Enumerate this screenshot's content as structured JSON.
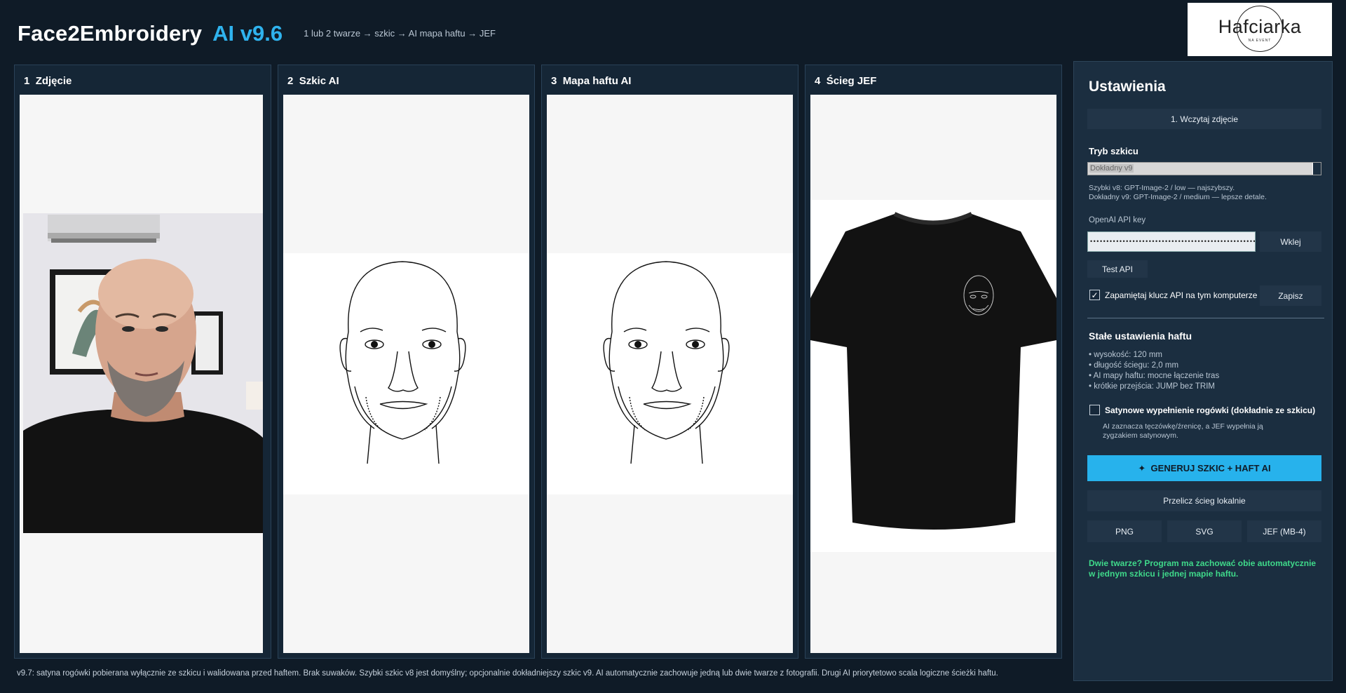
{
  "header": {
    "title": "Face2Embroidery",
    "version": "AI v9.6",
    "subtitle": "1 lub 2 twarze → szkic → AI mapa haftu → JEF",
    "logo_text": "Hafciarka",
    "logo_subtext": "NA EVENT"
  },
  "panels": [
    {
      "number": "1",
      "title": "Zdjęcie"
    },
    {
      "number": "2",
      "title": "Szkic AI"
    },
    {
      "number": "3",
      "title": "Mapa haftu AI"
    },
    {
      "number": "4",
      "title": "Ścieg JEF"
    }
  ],
  "settings": {
    "title": "Ustawienia",
    "load_button": "1. Wczytaj zdjęcie",
    "sketch_mode_label": "Tryb szkicu",
    "sketch_mode_value": "Dokładny v9",
    "mode_help_1": "Szybki v8: GPT-Image-2 / low — najszybszy.",
    "mode_help_2": "Dokładny v9: GPT-Image-2 / medium — lepsze detale.",
    "api_key_label": "OpenAI API key",
    "api_key_value": "••••••••••••••••••••••••••••••••••••••••••••••••••••••••••••••••••••••••••••••••",
    "paste_button": "Wklej",
    "test_api_button": "Test API",
    "remember_label": "Zapamiętaj klucz API na tym komputerze",
    "remember_checked": true,
    "save_button": "Zapisz",
    "fixed_settings_title": "Stałe ustawienia haftu",
    "bullets": [
      "• wysokość: 120 mm",
      "• długość ściegu: 2,0 mm",
      "• AI mapy haftu: mocne łączenie tras",
      "• krótkie przejścia: JUMP bez TRIM"
    ],
    "satin_label": "Satynowe wypełnienie rogówki (dokładnie ze szkicu)",
    "satin_checked": false,
    "satin_help_1": "AI zaznacza tęczówkę/źrenicę, a JEF wypełnia ją",
    "satin_help_2": "zygzakiem satynowym.",
    "generate_button": "GENERUJ SZKIC + HAFT AI",
    "generate_icon": "✦",
    "recalc_button": "Przelicz ścieg lokalnie",
    "export_png": "PNG",
    "export_svg": "SVG",
    "export_jef": "JEF (MB-4)",
    "note_line_1": "Dwie twarze? Program ma zachować obie automatycznie",
    "note_line_2": "w jednym szkicu i jednej mapie haftu."
  },
  "footer": {
    "text": "v9.7: satyna rogówki pobierana wyłącznie ze szkicu i walidowana przed haftem. Brak suwaków. Szybki szkic v8 jest domyślny; opcjonalnie dokładniejszy szkic v9. AI automatycznie zachowuje jedną lub dwie twarze z fotografii. Drugi AI priorytetowo scala logiczne ścieżki haftu."
  },
  "colors": {
    "background": "#0f1b27",
    "accent": "#2fb3ee",
    "note_green": "#3fd98a"
  }
}
